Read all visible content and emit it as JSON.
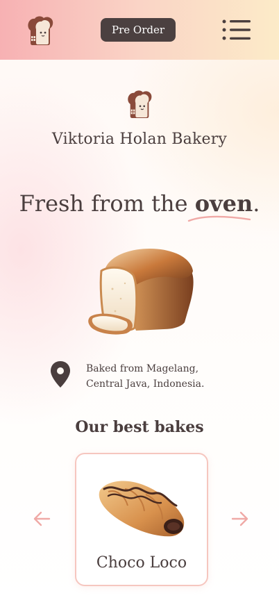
{
  "header": {
    "logo_icon": "bread-toast-icon",
    "preorder_label": "Pre Order",
    "menu_icon": "menu-list-icon"
  },
  "brand": {
    "logo_icon": "bread-toast-icon",
    "name": "Viktoria Holan Bakery"
  },
  "hero": {
    "title_prefix": "Fresh from the ",
    "title_emphasis": "oven",
    "title_suffix": ".",
    "image": "loaf-of-bread-illustration"
  },
  "location": {
    "icon": "location-pin-icon",
    "line1": "Baked from Magelang,",
    "line2": "Central Java, Indonesia."
  },
  "best_bakes": {
    "title": "Our best bakes",
    "prev_icon": "arrow-left-icon",
    "next_icon": "arrow-right-icon",
    "items": [
      {
        "name": "Choco Loco",
        "image": "chocolate-croissant-illustration"
      }
    ]
  },
  "colors": {
    "header_gradient_start": "#f7b1b3",
    "header_gradient_end": "#fcebc8",
    "button_dark": "#4b4040",
    "text_primary": "#4a3e3e",
    "accent_pink": "#f0a9a6",
    "card_border": "#f6c6bf"
  }
}
